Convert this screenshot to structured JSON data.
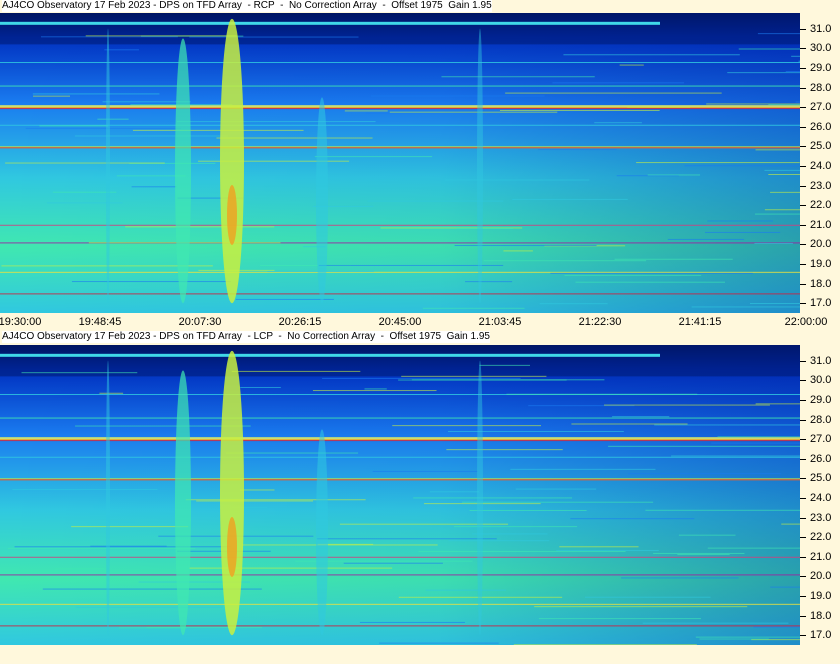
{
  "chart_data": [
    {
      "type": "heatmap",
      "title": "AJ4CO Observatory 17 Feb 2023 - DPS on TFD Array  - RCP  -  No Correction Array  -  Offset 1975  Gain 1.95",
      "polarization": "RCP",
      "x_ticks": [
        "19:30:00",
        "19:48:45",
        "20:07:30",
        "20:26:15",
        "20:45:00",
        "21:03:45",
        "21:22:30",
        "21:41:15",
        "22:00:00"
      ],
      "y_ticks": [
        "31.0",
        "30.0",
        "29.0",
        "28.0",
        "27.0",
        "26.0",
        "25.0",
        "24.0",
        "23.0",
        "22.0",
        "21.0",
        "20.0",
        "19.0",
        "18.0",
        "17.0"
      ],
      "xlim": [
        "19:30:00",
        "22:00:00"
      ],
      "ylim": [
        16.5,
        31.8
      ],
      "colormap": [
        "#001050",
        "#0030c0",
        "#1a7cf0",
        "#30c8e0",
        "#40e8b0",
        "#c8f040",
        "#f0a020",
        "#d02040"
      ]
    },
    {
      "type": "heatmap",
      "title": "AJ4CO Observatory 17 Feb 2023 - DPS on TFD Array  - LCP  -  No Correction Array  -  Offset 1975  Gain 1.95",
      "polarization": "LCP",
      "x_ticks": [],
      "y_ticks": [
        "31.0",
        "30.0",
        "29.0",
        "28.0",
        "27.0",
        "26.0",
        "25.0",
        "24.0",
        "23.0",
        "22.0",
        "21.0",
        "20.0",
        "19.0",
        "18.0",
        "17.0"
      ],
      "xlim": [
        "19:30:00",
        "22:00:00"
      ],
      "ylim": [
        16.5,
        31.8
      ],
      "colormap": [
        "#001050",
        "#0030c0",
        "#1a7cf0",
        "#30c8e0",
        "#40e8b0",
        "#c8f040",
        "#f0a020",
        "#d02040"
      ]
    }
  ]
}
